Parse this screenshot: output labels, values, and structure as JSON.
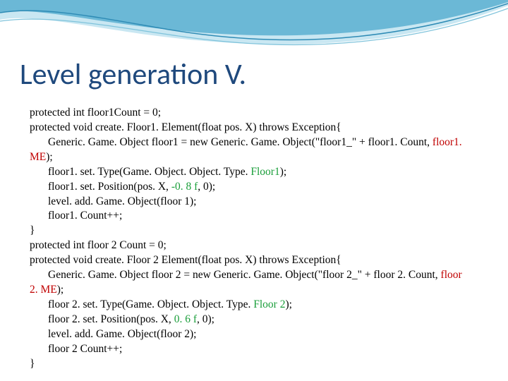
{
  "title": "Level generation V.",
  "code": {
    "l1": "protected int floor1Count = 0;",
    "l2": "protected void create. Floor1. Element(float pos. X) throws Exception{",
    "l3a": "Generic. Game. Object floor1 = new Generic. Game. Object(\"floor1_\" + floor1. Count, ",
    "l3b": "floor1. ME",
    "l3c": ");",
    "l4a": "floor1. set. Type(Game. Object. Object. Type. ",
    "l4b": "Floor1",
    "l4c": ");",
    "l5a": "floor1. set. Position(pos. X, ",
    "l5b": "-0. 8 f",
    "l5c": ", 0);",
    "l6": "level. add. Game. Object(floor 1);",
    "l7": "floor1. Count++;",
    "l8": "}",
    "l9": "protected int floor 2 Count = 0;",
    "l10": "protected void create. Floor 2 Element(float pos. X) throws Exception{",
    "l11a": "Generic. Game. Object floor 2 = new Generic. Game. Object(\"floor 2_\" + floor 2. Count, ",
    "l11b": "floor 2. ME",
    "l11c": ");",
    "l12a": "floor 2. set. Type(Game. Object. Object. Type. ",
    "l12b": "Floor 2",
    "l12c": ");",
    "l13a": "floor 2. set. Position(pos. X, ",
    "l13b": "0. 6 f",
    "l13c": ", 0);",
    "l14": "level. add. Game. Object(floor 2);",
    "l15": "floor 2 Count++;",
    "l16": "}"
  }
}
